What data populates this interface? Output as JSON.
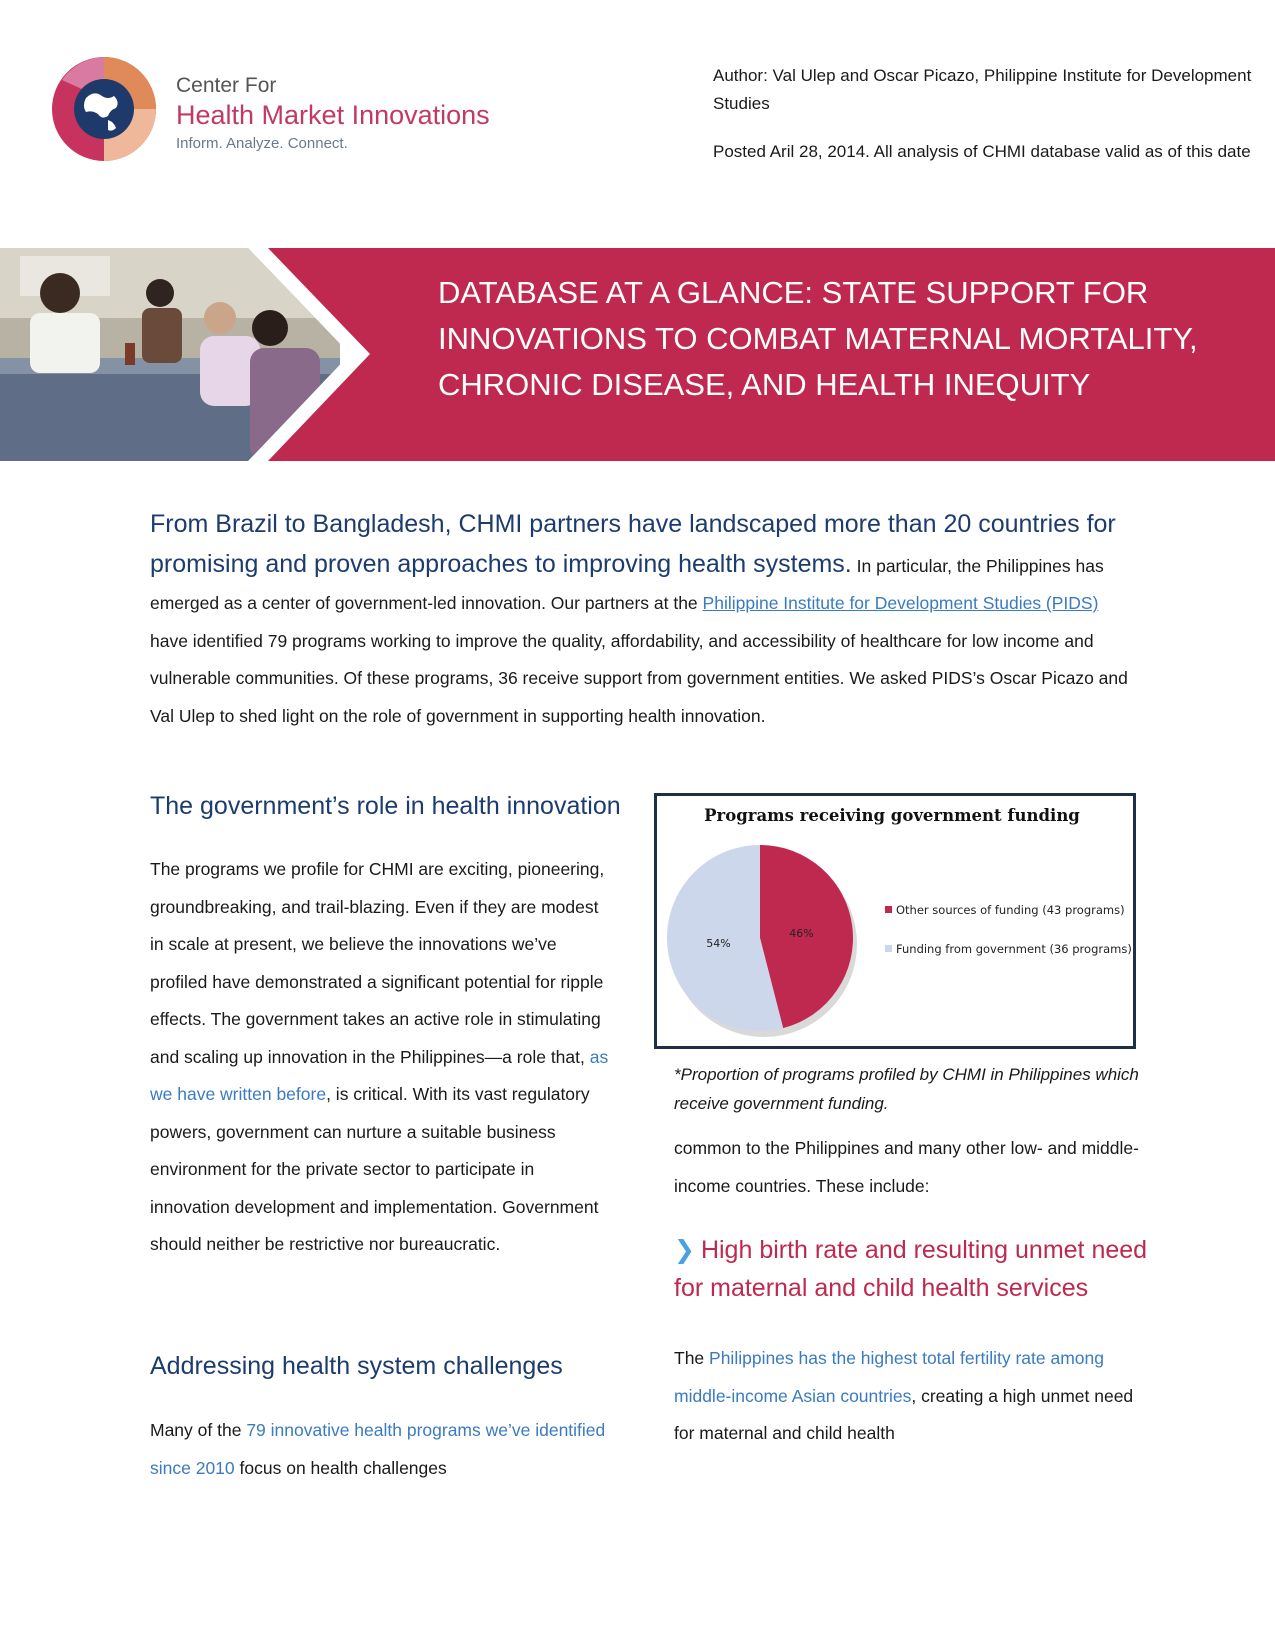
{
  "logo": {
    "line1": "Center For",
    "line2": "Health Market Innovations",
    "line3": "Inform. Analyze. Connect."
  },
  "meta": {
    "author": "Author: Val Ulep and Oscar Picazo, Philippine Institute for Development Studies",
    "posted": "Posted  Aril 28, 2014. All analysis of CHMI database valid as of this date"
  },
  "banner": {
    "title": "DATABASE AT A GLANCE: STATE SUPPORT FOR INNOVATIONS TO COMBAT MATERNAL MORTALITY, CHRONIC DISEASE, AND HEALTH INEQUITY"
  },
  "intro": {
    "lead": "From Brazil to Bangladesh, CHMI partners have landscaped more than 20 countries for promising and proven approaches to improving health systems.",
    "text1": " In particular, the Philippines has emerged as a center of government-led innovation. Our partners at the ",
    "link": "Philippine Institute for Development Studies (PIDS)",
    "text2": " have identified 79 programs working to improve the quality, affordability, and accessibility of healthcare for low income and vulnerable communities. Of these programs, 36 receive support from government entities. We asked PIDS’s Oscar Picazo and Val Ulep to shed light on the role of government in supporting health innovation."
  },
  "section_role": {
    "heading": "The government’s role in health innovation",
    "text1": "The programs we profile for CHMI are exciting, pioneering, groundbreaking, and trail-blazing. Even if they are modest in scale at present, we believe the innovations we’ve profiled have demonstrated a significant potential for ripple effects. The government takes an active role in stimulating and scaling up innovation in the Philippines—a role that, ",
    "link": "as we have written before",
    "text2": ", is critical. With its vast regulatory powers, government can nurture a suitable business environment for the private sector to participate in innovation development and implementation. Government should neither be restrictive nor bureaucratic."
  },
  "section_challenges": {
    "heading": "Addressing health system challenges",
    "text1": "Many of the ",
    "link": "79 innovative health programs we’ve identified since 2010",
    "text2": " focus on health challenges"
  },
  "right_column": {
    "continuation": "common to the Philippines and many other low- and middle-income countries. These include:",
    "subheading": "High birth rate and resulting unmet need for maternal and child health services",
    "phil_text1": "The ",
    "phil_link": "Philippines has the highest total fertility rate among middle-income Asian countries",
    "phil_text2": ", creating a high unmet need for maternal and child health"
  },
  "chart_caption": "*Proportion of programs profiled by CHMI in Philippines which receive government funding.",
  "colors": {
    "brand_crimson": "#c0294f",
    "navy": "#1d3c6e",
    "link_blue": "#3a7bc0",
    "pie_gov": "#cdd7ec"
  },
  "chart_data": {
    "type": "pie",
    "title": "Programs receiving government funding",
    "slices": [
      {
        "label": "Other sources of funding (43 programs)",
        "value": 46,
        "display": "46%",
        "color": "#c0294f"
      },
      {
        "label": "Funding from government (36 programs)",
        "value": 54,
        "display": "54%",
        "color": "#cdd7ec"
      }
    ],
    "legend": "right"
  }
}
